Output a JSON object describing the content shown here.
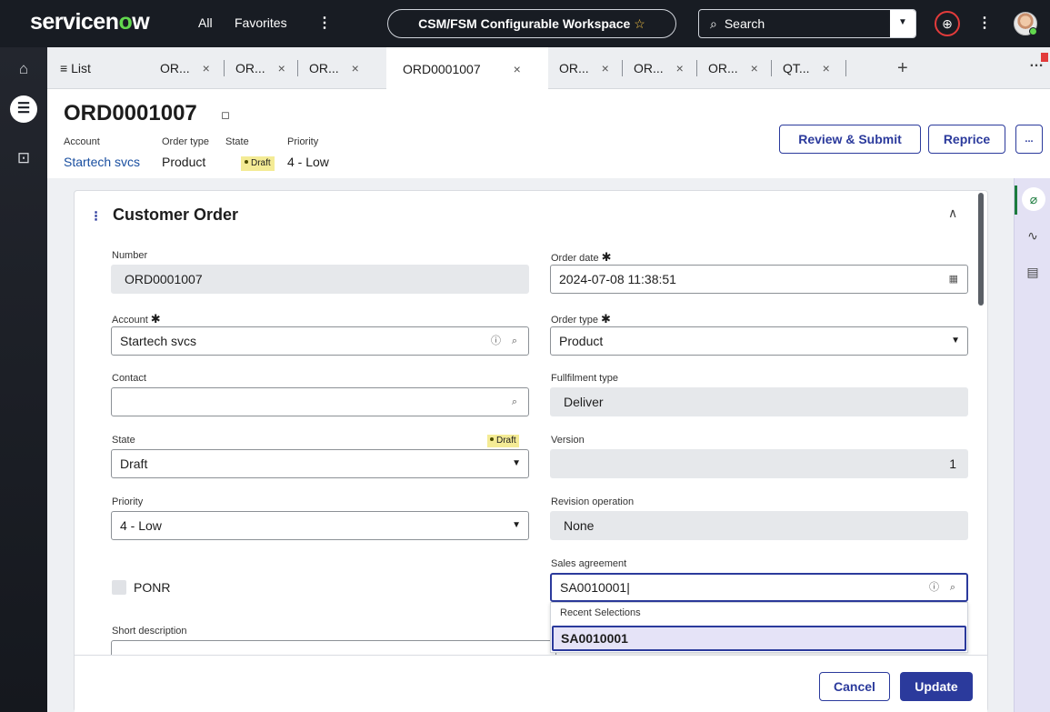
{
  "header": {
    "logo": "servicenow",
    "nav_all": "All",
    "nav_favorites": "Favorites",
    "kebab": "⋮",
    "workspace": "CSM/FSM Configurable Workspace",
    "search_placeholder": "Search"
  },
  "tabs": {
    "list_label": "List",
    "items": [
      {
        "label": "OR..."
      },
      {
        "label": "OR..."
      },
      {
        "label": "OR..."
      },
      {
        "label": "ORD0001007"
      },
      {
        "label": "OR..."
      },
      {
        "label": "OR..."
      },
      {
        "label": "OR..."
      },
      {
        "label": "QT..."
      }
    ],
    "close": "×",
    "add": "+"
  },
  "record": {
    "number": "ORD0001007",
    "meta": {
      "account_label": "Account",
      "account_value": "Startech svcs",
      "order_type_label": "Order type",
      "order_type_value": "Product",
      "state_label": "State",
      "state_value": "Draft",
      "priority_label": "Priority",
      "priority_value": "4 - Low"
    },
    "buttons": {
      "review_submit": "Review & Submit",
      "reprice": "Reprice",
      "more": "..."
    }
  },
  "form": {
    "section_title": "Customer Order",
    "number": {
      "label": "Number",
      "value": "ORD0001007"
    },
    "order_date": {
      "label": "Order date",
      "value": "2024-07-08 11:38:51"
    },
    "account": {
      "label": "Account",
      "value": "Startech svcs"
    },
    "order_type": {
      "label": "Order type",
      "value": "Product"
    },
    "contact": {
      "label": "Contact",
      "value": ""
    },
    "fulfilment_type": {
      "label": "Fullfilment type",
      "value": "Deliver"
    },
    "state": {
      "label": "State",
      "value": "Draft",
      "badge": "Draft"
    },
    "version": {
      "label": "Version",
      "value": "1"
    },
    "priority": {
      "label": "Priority",
      "value": "4 - Low"
    },
    "revision_operation": {
      "label": "Revision operation",
      "value": "None"
    },
    "sales_agreement": {
      "label": "Sales agreement",
      "value": "SA0010001"
    },
    "ponr": {
      "label": "PONR"
    },
    "short_description": {
      "label": "Short description"
    },
    "required_mark": "✱",
    "dropdown": {
      "header": "Recent Selections",
      "option": "SA0010001"
    }
  },
  "footer": {
    "cancel": "Cancel",
    "update": "Update"
  },
  "colors": {
    "header_bg": "#181c23",
    "accent": "#2b3a9c",
    "logo_green": "#62d84e",
    "draft_badge": "#f4eb95"
  }
}
